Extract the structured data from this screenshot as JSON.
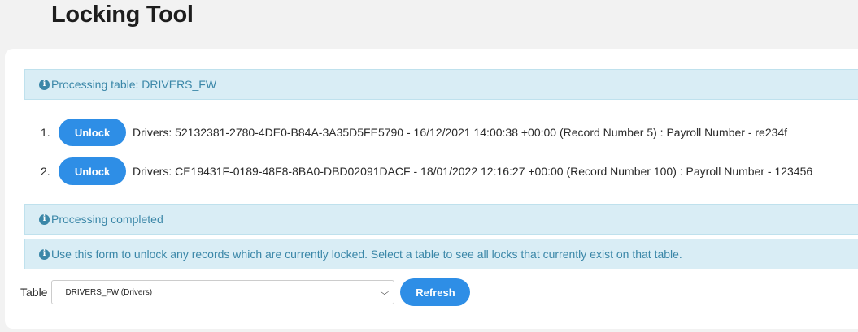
{
  "header": {
    "title": "Locking Tool"
  },
  "alerts": {
    "processing": "Processing table: DRIVERS_FW",
    "completed": "Processing completed",
    "help": "Use this form to unlock any records which are currently locked. Select a table to see all locks that currently exist on that table."
  },
  "locks": [
    {
      "num": "1.",
      "button": "Unlock",
      "text": "Drivers: 52132381-2780-4DE0-B84A-3A35D5FE5790 - 16/12/2021 14:00:38 +00:00 (Record Number 5) : Payroll Number - re234f"
    },
    {
      "num": "2.",
      "button": "Unlock",
      "text": "Drivers: CE19431F-0189-48F8-8BA0-DBD02091DACF - 18/01/2022 12:16:27 +00:00 (Record Number 100) : Payroll Number - 123456"
    }
  ],
  "form": {
    "table_label": "Table",
    "selected_table": "DRIVERS_FW (Drivers)",
    "refresh_label": "Refresh"
  },
  "icons": {
    "info": "info-circle-icon",
    "dropdown": "chevron-down-icon"
  },
  "colors": {
    "accent": "#2e8ee6",
    "alert_bg": "#d9edf5",
    "alert_text": "#3b87a8"
  }
}
